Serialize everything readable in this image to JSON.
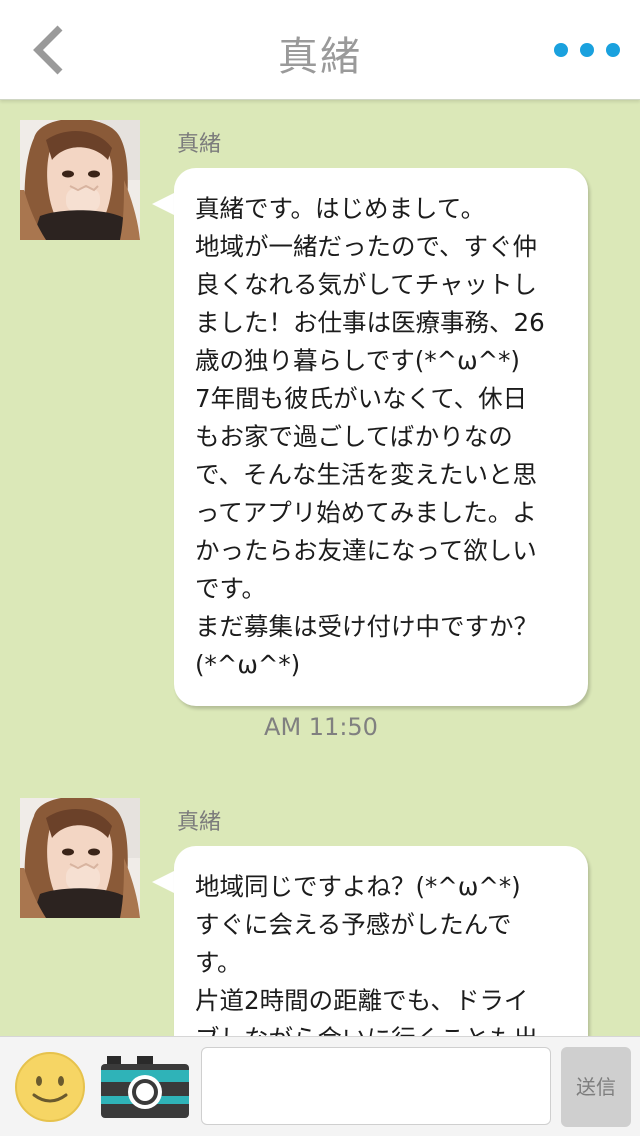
{
  "header": {
    "title": "真緒",
    "back_icon": "chevron-left-icon",
    "more_icon": "more-dots-icon",
    "accent_color": "#1aa1de"
  },
  "messages": [
    {
      "sender": "真緒",
      "lines": [
        "真緒です。はじめまして。",
        "地域が一緒だったので、すぐ仲",
        "良くなれる気がしてチャットし",
        "ました！お仕事は医療事務、26",
        "歳の独り暮らしです(*^ω^*)",
        "7年間も彼氏がいなくて、休日",
        "もお家で過ごしてばかりなの",
        "で、そんな生活を変えたいと思",
        "ってアプリ始めてみました。よ",
        "かったらお友達になって欲しい",
        "です。",
        "まだ募集は受け付け中ですか？",
        "(*^ω^*)"
      ],
      "time": "AM 11:50"
    },
    {
      "sender": "真緒",
      "lines": [
        "地域同じですよね？(*^ω^*)",
        "すぐに会える予感がしたんで",
        "す。",
        "片道2時間の距離でも、ドライ",
        "ブしながら会いに行くことも出"
      ]
    }
  ],
  "input": {
    "placeholder": "",
    "value": "",
    "send_label": "送信",
    "emoji_icon": "smiley-icon",
    "camera_icon": "camera-icon"
  },
  "colors": {
    "chat_background": "#dbe8b8",
    "bubble": "#ffffff",
    "send_button": "#cfcfcf"
  }
}
